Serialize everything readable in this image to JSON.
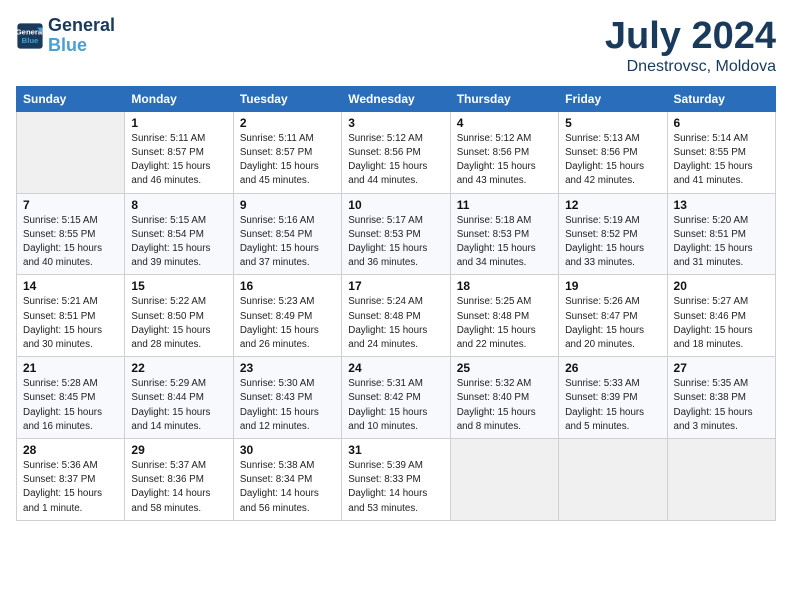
{
  "header": {
    "logo_line1": "General",
    "logo_line2": "Blue",
    "title": "July 2024",
    "subtitle": "Dnestrovsc, Moldova"
  },
  "calendar": {
    "days_of_week": [
      "Sunday",
      "Monday",
      "Tuesday",
      "Wednesday",
      "Thursday",
      "Friday",
      "Saturday"
    ],
    "weeks": [
      [
        {
          "day": "",
          "info": ""
        },
        {
          "day": "1",
          "info": "Sunrise: 5:11 AM\nSunset: 8:57 PM\nDaylight: 15 hours\nand 46 minutes."
        },
        {
          "day": "2",
          "info": "Sunrise: 5:11 AM\nSunset: 8:57 PM\nDaylight: 15 hours\nand 45 minutes."
        },
        {
          "day": "3",
          "info": "Sunrise: 5:12 AM\nSunset: 8:56 PM\nDaylight: 15 hours\nand 44 minutes."
        },
        {
          "day": "4",
          "info": "Sunrise: 5:12 AM\nSunset: 8:56 PM\nDaylight: 15 hours\nand 43 minutes."
        },
        {
          "day": "5",
          "info": "Sunrise: 5:13 AM\nSunset: 8:56 PM\nDaylight: 15 hours\nand 42 minutes."
        },
        {
          "day": "6",
          "info": "Sunrise: 5:14 AM\nSunset: 8:55 PM\nDaylight: 15 hours\nand 41 minutes."
        }
      ],
      [
        {
          "day": "7",
          "info": "Sunrise: 5:15 AM\nSunset: 8:55 PM\nDaylight: 15 hours\nand 40 minutes."
        },
        {
          "day": "8",
          "info": "Sunrise: 5:15 AM\nSunset: 8:54 PM\nDaylight: 15 hours\nand 39 minutes."
        },
        {
          "day": "9",
          "info": "Sunrise: 5:16 AM\nSunset: 8:54 PM\nDaylight: 15 hours\nand 37 minutes."
        },
        {
          "day": "10",
          "info": "Sunrise: 5:17 AM\nSunset: 8:53 PM\nDaylight: 15 hours\nand 36 minutes."
        },
        {
          "day": "11",
          "info": "Sunrise: 5:18 AM\nSunset: 8:53 PM\nDaylight: 15 hours\nand 34 minutes."
        },
        {
          "day": "12",
          "info": "Sunrise: 5:19 AM\nSunset: 8:52 PM\nDaylight: 15 hours\nand 33 minutes."
        },
        {
          "day": "13",
          "info": "Sunrise: 5:20 AM\nSunset: 8:51 PM\nDaylight: 15 hours\nand 31 minutes."
        }
      ],
      [
        {
          "day": "14",
          "info": "Sunrise: 5:21 AM\nSunset: 8:51 PM\nDaylight: 15 hours\nand 30 minutes."
        },
        {
          "day": "15",
          "info": "Sunrise: 5:22 AM\nSunset: 8:50 PM\nDaylight: 15 hours\nand 28 minutes."
        },
        {
          "day": "16",
          "info": "Sunrise: 5:23 AM\nSunset: 8:49 PM\nDaylight: 15 hours\nand 26 minutes."
        },
        {
          "day": "17",
          "info": "Sunrise: 5:24 AM\nSunset: 8:48 PM\nDaylight: 15 hours\nand 24 minutes."
        },
        {
          "day": "18",
          "info": "Sunrise: 5:25 AM\nSunset: 8:48 PM\nDaylight: 15 hours\nand 22 minutes."
        },
        {
          "day": "19",
          "info": "Sunrise: 5:26 AM\nSunset: 8:47 PM\nDaylight: 15 hours\nand 20 minutes."
        },
        {
          "day": "20",
          "info": "Sunrise: 5:27 AM\nSunset: 8:46 PM\nDaylight: 15 hours\nand 18 minutes."
        }
      ],
      [
        {
          "day": "21",
          "info": "Sunrise: 5:28 AM\nSunset: 8:45 PM\nDaylight: 15 hours\nand 16 minutes."
        },
        {
          "day": "22",
          "info": "Sunrise: 5:29 AM\nSunset: 8:44 PM\nDaylight: 15 hours\nand 14 minutes."
        },
        {
          "day": "23",
          "info": "Sunrise: 5:30 AM\nSunset: 8:43 PM\nDaylight: 15 hours\nand 12 minutes."
        },
        {
          "day": "24",
          "info": "Sunrise: 5:31 AM\nSunset: 8:42 PM\nDaylight: 15 hours\nand 10 minutes."
        },
        {
          "day": "25",
          "info": "Sunrise: 5:32 AM\nSunset: 8:40 PM\nDaylight: 15 hours\nand 8 minutes."
        },
        {
          "day": "26",
          "info": "Sunrise: 5:33 AM\nSunset: 8:39 PM\nDaylight: 15 hours\nand 5 minutes."
        },
        {
          "day": "27",
          "info": "Sunrise: 5:35 AM\nSunset: 8:38 PM\nDaylight: 15 hours\nand 3 minutes."
        }
      ],
      [
        {
          "day": "28",
          "info": "Sunrise: 5:36 AM\nSunset: 8:37 PM\nDaylight: 15 hours\nand 1 minute."
        },
        {
          "day": "29",
          "info": "Sunrise: 5:37 AM\nSunset: 8:36 PM\nDaylight: 14 hours\nand 58 minutes."
        },
        {
          "day": "30",
          "info": "Sunrise: 5:38 AM\nSunset: 8:34 PM\nDaylight: 14 hours\nand 56 minutes."
        },
        {
          "day": "31",
          "info": "Sunrise: 5:39 AM\nSunset: 8:33 PM\nDaylight: 14 hours\nand 53 minutes."
        },
        {
          "day": "",
          "info": ""
        },
        {
          "day": "",
          "info": ""
        },
        {
          "day": "",
          "info": ""
        }
      ]
    ]
  }
}
